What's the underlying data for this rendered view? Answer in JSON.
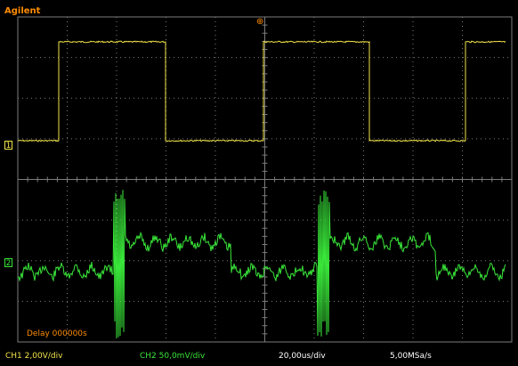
{
  "brand": "Agilent",
  "colors": {
    "brand": "#ff8c00",
    "ch1": "#f2e44a",
    "ch2": "#39e639",
    "grid": "#7c7c7c",
    "timebase": "#ffffff",
    "delay": "#ff8c00"
  },
  "markers": {
    "ch1": "1",
    "ch2": "2",
    "trigger_icon": "trigger-icon"
  },
  "delay_text": "Delay  000000s",
  "status": {
    "ch1_scale": "CH1  2,00V/div",
    "ch2_scale": "CH2  50,0mV/div",
    "timebase": "20,00us/div",
    "sample_rate": "5,00MSa/s"
  }
}
